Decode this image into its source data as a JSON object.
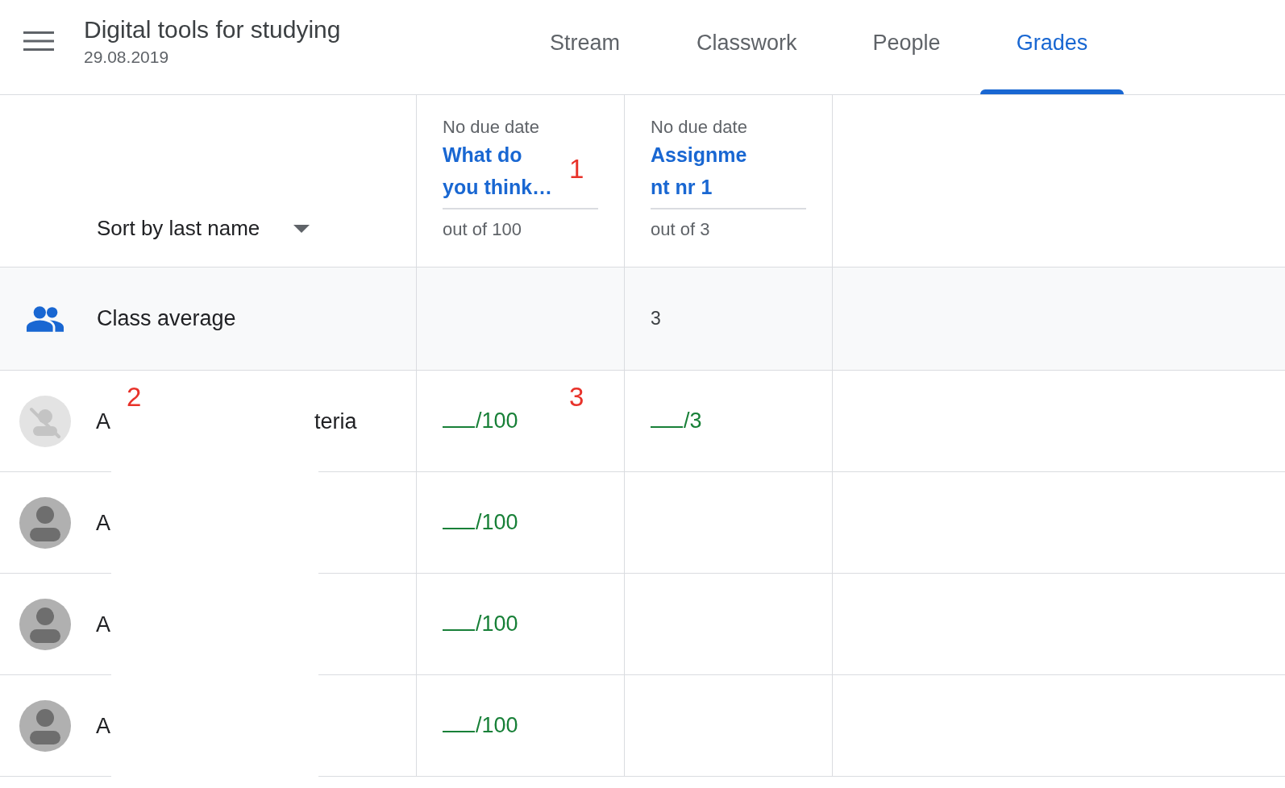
{
  "header": {
    "title": "Digital tools for studying",
    "subtitle": "29.08.2019"
  },
  "tabs": [
    {
      "label": "Stream",
      "selected": false
    },
    {
      "label": "Classwork",
      "selected": false
    },
    {
      "label": "People",
      "selected": false
    },
    {
      "label": "Grades",
      "selected": true
    }
  ],
  "sort": {
    "label": "Sort by last name"
  },
  "assignments": [
    {
      "due": "No due date",
      "title": "What do you think…",
      "points": "out of 100",
      "marker": "1"
    },
    {
      "due": "No due date",
      "title": "Assignment nr 1",
      "points": "out of 3",
      "average": "3"
    }
  ],
  "class_average": {
    "label": "Class average"
  },
  "students": [
    {
      "kind": "no-photo",
      "name_start": "A",
      "name_end": "teria",
      "name_marker": "2",
      "grades": [
        {
          "out_of": "/100",
          "marker": "3"
        },
        {
          "out_of": "/3"
        }
      ]
    },
    {
      "kind": "default",
      "name_start": "A",
      "grades": [
        {
          "out_of": "/100"
        }
      ]
    },
    {
      "kind": "default",
      "name_start": "A",
      "grades": [
        {
          "out_of": "/100"
        }
      ]
    },
    {
      "kind": "default",
      "name_start": "A",
      "grades": [
        {
          "out_of": "/100"
        }
      ]
    }
  ]
}
